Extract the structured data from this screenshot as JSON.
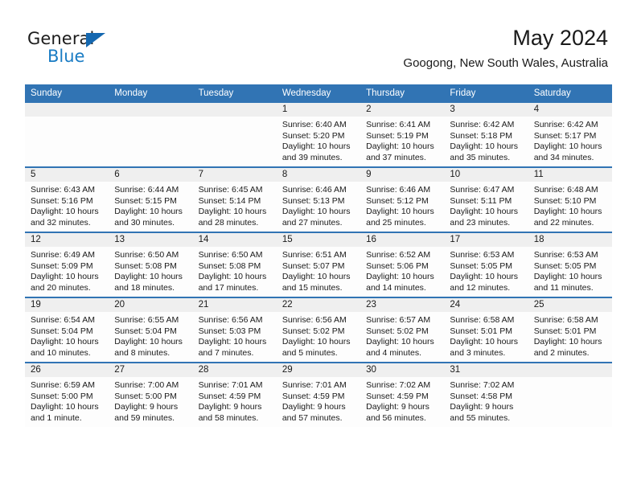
{
  "brand": {
    "name_part1": "General",
    "name_part2": "Blue",
    "triangle_color": "#1568b0",
    "blue_text_color": "#1a7cc4"
  },
  "header": {
    "month_title": "May 2024",
    "location": "Googong, New South Wales, Australia"
  },
  "theme": {
    "header_row_color": "#3174b4",
    "daynum_band_color": "#efefef",
    "cell_background": "#fdfdfd",
    "text_color": "#1a1a1a"
  },
  "calendar": {
    "weekday_headers": [
      "Sunday",
      "Monday",
      "Tuesday",
      "Wednesday",
      "Thursday",
      "Friday",
      "Saturday"
    ],
    "weeks": [
      [
        {
          "empty": true
        },
        {
          "empty": true
        },
        {
          "empty": true
        },
        {
          "day": "1",
          "sunrise": "Sunrise: 6:40 AM",
          "sunset": "Sunset: 5:20 PM",
          "daylight1": "Daylight: 10 hours",
          "daylight2": "and 39 minutes."
        },
        {
          "day": "2",
          "sunrise": "Sunrise: 6:41 AM",
          "sunset": "Sunset: 5:19 PM",
          "daylight1": "Daylight: 10 hours",
          "daylight2": "and 37 minutes."
        },
        {
          "day": "3",
          "sunrise": "Sunrise: 6:42 AM",
          "sunset": "Sunset: 5:18 PM",
          "daylight1": "Daylight: 10 hours",
          "daylight2": "and 35 minutes."
        },
        {
          "day": "4",
          "sunrise": "Sunrise: 6:42 AM",
          "sunset": "Sunset: 5:17 PM",
          "daylight1": "Daylight: 10 hours",
          "daylight2": "and 34 minutes."
        }
      ],
      [
        {
          "day": "5",
          "sunrise": "Sunrise: 6:43 AM",
          "sunset": "Sunset: 5:16 PM",
          "daylight1": "Daylight: 10 hours",
          "daylight2": "and 32 minutes."
        },
        {
          "day": "6",
          "sunrise": "Sunrise: 6:44 AM",
          "sunset": "Sunset: 5:15 PM",
          "daylight1": "Daylight: 10 hours",
          "daylight2": "and 30 minutes."
        },
        {
          "day": "7",
          "sunrise": "Sunrise: 6:45 AM",
          "sunset": "Sunset: 5:14 PM",
          "daylight1": "Daylight: 10 hours",
          "daylight2": "and 28 minutes."
        },
        {
          "day": "8",
          "sunrise": "Sunrise: 6:46 AM",
          "sunset": "Sunset: 5:13 PM",
          "daylight1": "Daylight: 10 hours",
          "daylight2": "and 27 minutes."
        },
        {
          "day": "9",
          "sunrise": "Sunrise: 6:46 AM",
          "sunset": "Sunset: 5:12 PM",
          "daylight1": "Daylight: 10 hours",
          "daylight2": "and 25 minutes."
        },
        {
          "day": "10",
          "sunrise": "Sunrise: 6:47 AM",
          "sunset": "Sunset: 5:11 PM",
          "daylight1": "Daylight: 10 hours",
          "daylight2": "and 23 minutes."
        },
        {
          "day": "11",
          "sunrise": "Sunrise: 6:48 AM",
          "sunset": "Sunset: 5:10 PM",
          "daylight1": "Daylight: 10 hours",
          "daylight2": "and 22 minutes."
        }
      ],
      [
        {
          "day": "12",
          "sunrise": "Sunrise: 6:49 AM",
          "sunset": "Sunset: 5:09 PM",
          "daylight1": "Daylight: 10 hours",
          "daylight2": "and 20 minutes."
        },
        {
          "day": "13",
          "sunrise": "Sunrise: 6:50 AM",
          "sunset": "Sunset: 5:08 PM",
          "daylight1": "Daylight: 10 hours",
          "daylight2": "and 18 minutes."
        },
        {
          "day": "14",
          "sunrise": "Sunrise: 6:50 AM",
          "sunset": "Sunset: 5:08 PM",
          "daylight1": "Daylight: 10 hours",
          "daylight2": "and 17 minutes."
        },
        {
          "day": "15",
          "sunrise": "Sunrise: 6:51 AM",
          "sunset": "Sunset: 5:07 PM",
          "daylight1": "Daylight: 10 hours",
          "daylight2": "and 15 minutes."
        },
        {
          "day": "16",
          "sunrise": "Sunrise: 6:52 AM",
          "sunset": "Sunset: 5:06 PM",
          "daylight1": "Daylight: 10 hours",
          "daylight2": "and 14 minutes."
        },
        {
          "day": "17",
          "sunrise": "Sunrise: 6:53 AM",
          "sunset": "Sunset: 5:05 PM",
          "daylight1": "Daylight: 10 hours",
          "daylight2": "and 12 minutes."
        },
        {
          "day": "18",
          "sunrise": "Sunrise: 6:53 AM",
          "sunset": "Sunset: 5:05 PM",
          "daylight1": "Daylight: 10 hours",
          "daylight2": "and 11 minutes."
        }
      ],
      [
        {
          "day": "19",
          "sunrise": "Sunrise: 6:54 AM",
          "sunset": "Sunset: 5:04 PM",
          "daylight1": "Daylight: 10 hours",
          "daylight2": "and 10 minutes."
        },
        {
          "day": "20",
          "sunrise": "Sunrise: 6:55 AM",
          "sunset": "Sunset: 5:04 PM",
          "daylight1": "Daylight: 10 hours",
          "daylight2": "and 8 minutes."
        },
        {
          "day": "21",
          "sunrise": "Sunrise: 6:56 AM",
          "sunset": "Sunset: 5:03 PM",
          "daylight1": "Daylight: 10 hours",
          "daylight2": "and 7 minutes."
        },
        {
          "day": "22",
          "sunrise": "Sunrise: 6:56 AM",
          "sunset": "Sunset: 5:02 PM",
          "daylight1": "Daylight: 10 hours",
          "daylight2": "and 5 minutes."
        },
        {
          "day": "23",
          "sunrise": "Sunrise: 6:57 AM",
          "sunset": "Sunset: 5:02 PM",
          "daylight1": "Daylight: 10 hours",
          "daylight2": "and 4 minutes."
        },
        {
          "day": "24",
          "sunrise": "Sunrise: 6:58 AM",
          "sunset": "Sunset: 5:01 PM",
          "daylight1": "Daylight: 10 hours",
          "daylight2": "and 3 minutes."
        },
        {
          "day": "25",
          "sunrise": "Sunrise: 6:58 AM",
          "sunset": "Sunset: 5:01 PM",
          "daylight1": "Daylight: 10 hours",
          "daylight2": "and 2 minutes."
        }
      ],
      [
        {
          "day": "26",
          "sunrise": "Sunrise: 6:59 AM",
          "sunset": "Sunset: 5:00 PM",
          "daylight1": "Daylight: 10 hours",
          "daylight2": "and 1 minute."
        },
        {
          "day": "27",
          "sunrise": "Sunrise: 7:00 AM",
          "sunset": "Sunset: 5:00 PM",
          "daylight1": "Daylight: 9 hours",
          "daylight2": "and 59 minutes."
        },
        {
          "day": "28",
          "sunrise": "Sunrise: 7:01 AM",
          "sunset": "Sunset: 4:59 PM",
          "daylight1": "Daylight: 9 hours",
          "daylight2": "and 58 minutes."
        },
        {
          "day": "29",
          "sunrise": "Sunrise: 7:01 AM",
          "sunset": "Sunset: 4:59 PM",
          "daylight1": "Daylight: 9 hours",
          "daylight2": "and 57 minutes."
        },
        {
          "day": "30",
          "sunrise": "Sunrise: 7:02 AM",
          "sunset": "Sunset: 4:59 PM",
          "daylight1": "Daylight: 9 hours",
          "daylight2": "and 56 minutes."
        },
        {
          "day": "31",
          "sunrise": "Sunrise: 7:02 AM",
          "sunset": "Sunset: 4:58 PM",
          "daylight1": "Daylight: 9 hours",
          "daylight2": "and 55 minutes."
        },
        {
          "empty": true
        }
      ]
    ]
  }
}
